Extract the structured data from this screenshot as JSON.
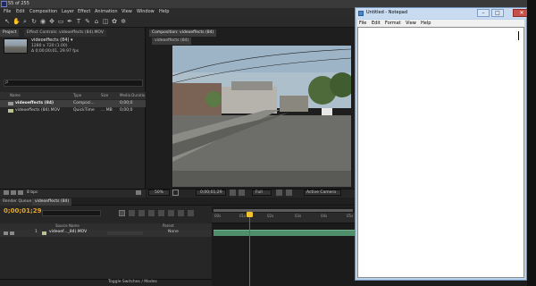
{
  "ae": {
    "window_title": "55 of 255",
    "menu": [
      "File",
      "Edit",
      "Composition",
      "Layer",
      "Effect",
      "Animation",
      "View",
      "Window",
      "Help"
    ],
    "project_panel": {
      "tabs": [
        "Project",
        "Effect Controls: videoeffects (84).MOV"
      ],
      "item_name": "videoeffects (84) ▾",
      "item_meta1": "1280 x 720 (1.00)",
      "item_meta2": "Δ 0;00;00;01, 29.97 fps",
      "search_placeholder": "ρ",
      "columns": [
        "Name",
        "Type",
        "Size",
        "Media Duratio"
      ],
      "rows": [
        {
          "name": "videoeffects (84)",
          "type": "Composi...",
          "size": "",
          "duration": "0;00;0"
        },
        {
          "name": "videoeffects (84).MOV",
          "type": "QuickTime",
          "size": "... MB",
          "duration": "0;00;0"
        }
      ],
      "footer_bpc": "8 bpc"
    },
    "comp_panel": {
      "tab": "Composition: videoeffects (84)",
      "breadcrumb": "videoeffects (84)",
      "zoom": "50%",
      "timecode": "0;00;01;29",
      "resolution": "Full",
      "camera": "Active Camera"
    },
    "timeline": {
      "tabs": [
        "Render Queue",
        "videoeffects (84)"
      ],
      "time": "0;00;01;29",
      "columns": [
        "Source Name",
        "Parent"
      ],
      "layer_number": "1",
      "layer_name": "videoef..._84).MOV",
      "parent": "None",
      "ruler": [
        "00s",
        "01s",
        "02s",
        "03s",
        "04s",
        "05s"
      ],
      "footer": "Toggle Switches / Modes"
    }
  },
  "notepad": {
    "title": "Untitled - Notepad",
    "menu": [
      "File",
      "Edit",
      "Format",
      "View",
      "Help"
    ],
    "content": "",
    "close_symbol": "✕",
    "min_symbol": "–",
    "max_symbol": "□"
  }
}
